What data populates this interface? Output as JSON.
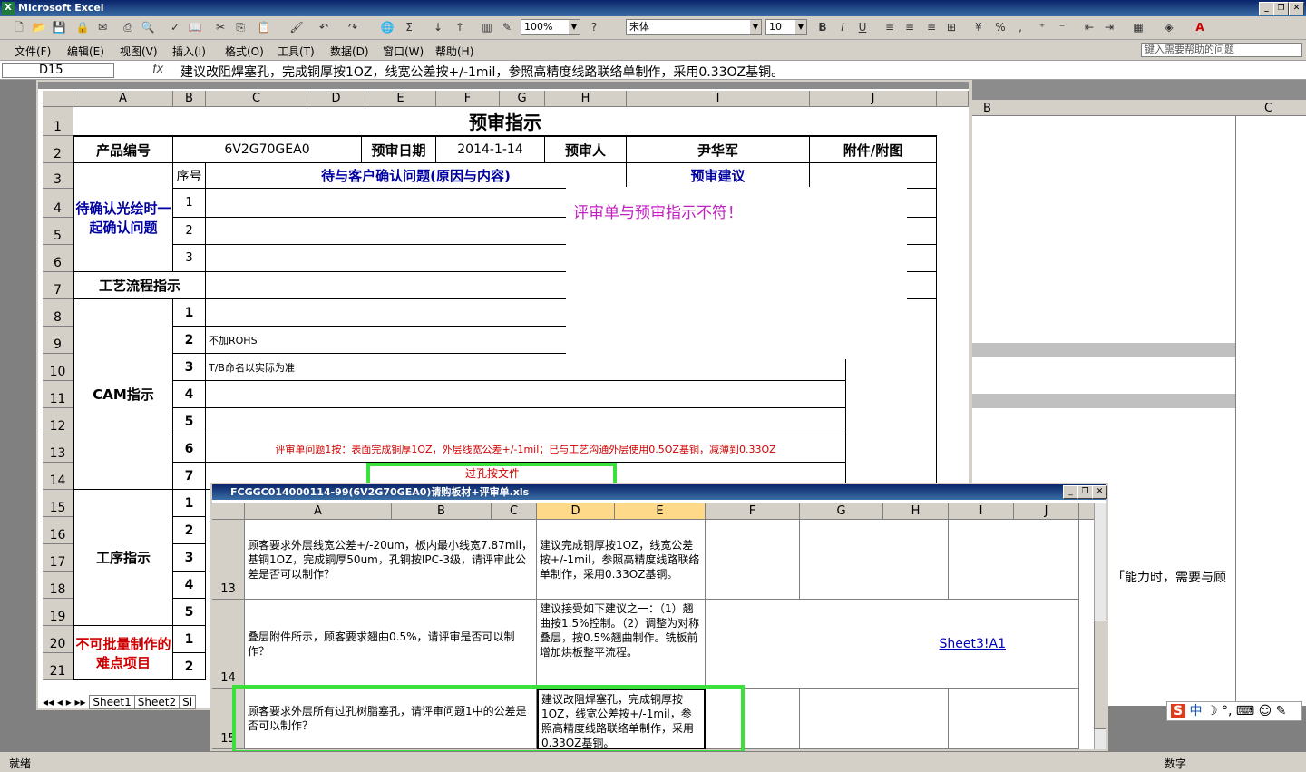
{
  "app": {
    "title": "Microsoft Excel",
    "name_box": "D15",
    "formula": "建议改阻焊塞孔，完成铜厚按1OZ，线宽公差按+/-1mil，参照高精度线路联络单制作，采用0.33OZ基铜。",
    "zoom": "100%",
    "font": "宋体",
    "font_size": "10",
    "help_placeholder": "键入需要帮助的问题",
    "status_left": "就绪",
    "status_right": "数字"
  },
  "menu": [
    "文件(F)",
    "编辑(E)",
    "视图(V)",
    "插入(I)",
    "格式(O)",
    "工具(T)",
    "数据(D)",
    "窗口(W)",
    "帮助(H)"
  ],
  "sheet": {
    "columns": [
      "A",
      "B",
      "C",
      "D",
      "E",
      "F",
      "G",
      "H",
      "I",
      "J"
    ],
    "rows": [
      "1",
      "2",
      "3",
      "4",
      "5",
      "6",
      "7",
      "8",
      "9",
      "10",
      "11",
      "12",
      "13",
      "14",
      "15",
      "16",
      "17",
      "18",
      "19",
      "20",
      "21"
    ],
    "title": "预审指示",
    "product_label": "产品编号",
    "product_value": "6V2G70GEA0",
    "date_label": "预审日期",
    "date_value": "2014-1-14",
    "reviewer_label": "预审人",
    "reviewer_value": "尹华军",
    "attach_label": "附件/附图",
    "seq_label": "序号",
    "issues_label": "待与客户确认问题(原因与内容)",
    "suggest_label": "预审建议",
    "confirm_label": "待确认光绘时一起确认问题",
    "process_label": "工艺流程指示",
    "cam_label": "CAM指示",
    "proc_label": "工序指示",
    "hard_label": "不可批量制作的难点项目",
    "cam_item2": "不加ROHS",
    "cam_item3": "T/B命名以实际为准",
    "cam_item6": "评审单问题1按：表面完成铜厚1OZ，外层线宽公差+/-1mil；已与工艺沟通外层使用0.5OZ基铜，减薄到0.33OZ",
    "cam_item7": "过孔按文件",
    "tabs": [
      "Sheet1",
      "Sheet2",
      "Sl"
    ],
    "note": "评审单与预审指示不符！",
    "seq": [
      "1",
      "2",
      "3",
      "1",
      "2",
      "3",
      "4",
      "5",
      "6",
      "7",
      "1",
      "2",
      "3",
      "4",
      "5",
      "1",
      "2"
    ]
  },
  "back_sheet": {
    "col_b": "B",
    "col_c": "C",
    "partial_text": "「能力时，需要与顾"
  },
  "window2": {
    "title": "FCGGC014000114-99(6V2G70GEA0)请购板材+评审单.xls",
    "columns": [
      "A",
      "B",
      "C",
      "D",
      "E",
      "F",
      "G",
      "H",
      "I",
      "J"
    ],
    "rows": [
      {
        "num": "13",
        "question": "顾客要求外层线宽公差+/-20um，板内最小线宽7.87mil，基铜1OZ，完成铜厚50um，孔铜按IPC-3级，请评审此公差是否可以制作？",
        "answer": "建议完成铜厚按1OZ，线宽公差按+/-1mil，参照高精度线路联络单制作，采用0.33OZ基铜。"
      },
      {
        "num": "14",
        "question": "叠层附件所示，顾客要求翘曲0.5%，请评审是否可以制作？",
        "answer": "建议接受如下建议之一：（1）翘曲按1.5%控制。（2）调整为对称叠层，按0.5%翘曲制作。铣板前增加烘板整平流程。",
        "link": "Sheet3!A1"
      },
      {
        "num": "15",
        "question": "顾客要求外层所有过孔树脂塞孔，请评审问题1中的公差是否可以制作？",
        "answer": "建议改阻焊塞孔，完成铜厚按1OZ，线宽公差按+/-1mil，参照高精度线路联络单制作，采用0.33OZ基铜。"
      }
    ]
  },
  "ime": "中"
}
